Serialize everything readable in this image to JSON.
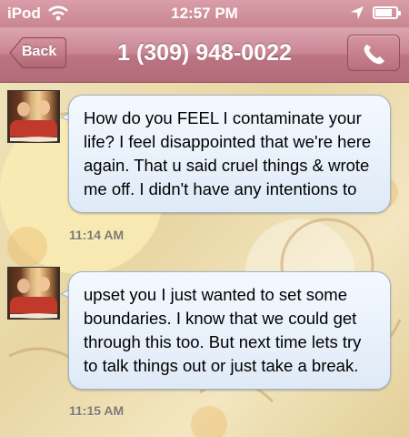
{
  "status_bar": {
    "carrier": "iPod",
    "time": "12:57 PM",
    "battery_level": 0.8,
    "icons": [
      "wifi-icon",
      "location-arrow-icon",
      "battery-icon"
    ]
  },
  "nav": {
    "back_label": "Back",
    "title": "1 (309) 948-0022",
    "call_icon": "phone-icon",
    "bar_color": "#c98592"
  },
  "messages": [
    {
      "text": "How do you FEEL I contaminate your life? I feel disappointed that we're here again. That u said cruel things & wrote me off. I didn't have any intentions to",
      "timestamp": "11:14 AM"
    },
    {
      "text": "upset you I just wanted to set some boundaries. I know that we could get through this too. But next time lets try to talk things out or just take a break.",
      "timestamp": "11:15 AM"
    }
  ]
}
